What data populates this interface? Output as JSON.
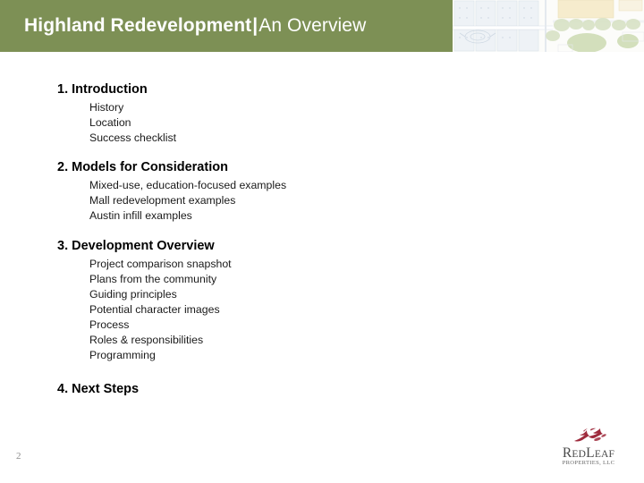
{
  "header": {
    "title_strong": "Highland Redevelopment",
    "title_separator": "|",
    "title_light": "An Overview",
    "band_color": "#7d9055",
    "map_image_name": "site-plan-aerial"
  },
  "agenda": {
    "sections": [
      {
        "heading": "1. Introduction",
        "items": [
          "History",
          "Location",
          "Success checklist"
        ]
      },
      {
        "heading": "2. Models for Consideration",
        "items": [
          "Mixed-use, education-focused examples",
          "Mall redevelopment examples",
          "Austin infill examples"
        ]
      },
      {
        "heading": "3. Development Overview",
        "items": [
          "Project comparison snapshot",
          "Plans from the community",
          "Guiding principles",
          "Potential character images",
          "Process",
          "Roles & responsibilities",
          "Programming"
        ]
      },
      {
        "heading": "4. Next Steps",
        "items": []
      }
    ]
  },
  "footer": {
    "page_number": "2",
    "logo": {
      "name_part1_cap": "R",
      "name_part1_rest": "ED",
      "name_part2_cap": "L",
      "name_part2_rest": "EAF",
      "tagline": "PROPERTIES, LLC",
      "mark_name": "red-leaf-icon",
      "mark_color": "#9e2a3c"
    }
  }
}
